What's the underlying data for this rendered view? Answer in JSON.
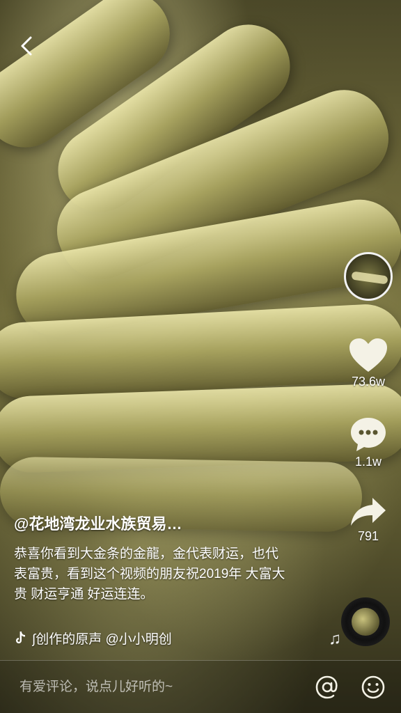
{
  "header": {
    "back_icon": "chevron-left-icon"
  },
  "rail": {
    "avatar_label": "creator-avatar",
    "like_count": "73.6w",
    "comment_count": "1.1w",
    "share_count": "791"
  },
  "caption": {
    "author": "@花地湾龙业水族贸易…",
    "description": "恭喜你看到大金条的金龍，金代表财运，也代表富贵，看到这个视频的朋友祝2019年 大富大贵 财运亨通 好运连连。"
  },
  "music": {
    "text": "∫创作的原声    @小小明创"
  },
  "comment_bar": {
    "placeholder": "有爱评论，说点儿好听的~"
  },
  "colors": {
    "accent": "#ffffff",
    "video_tint": "#77723f"
  }
}
